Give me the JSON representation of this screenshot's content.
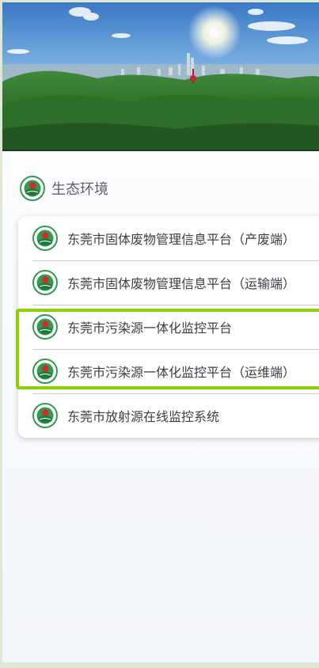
{
  "hero": {
    "icon": "city-forest-banner"
  },
  "section": {
    "title": "生态环境",
    "icon": "eco-env-logo-icon"
  },
  "platforms": [
    {
      "label": "东莞市固体废物管理信息平台（产废端）",
      "icon": "eco-env-logo-icon"
    },
    {
      "label": "东莞市固体废物管理信息平台（运输端）",
      "icon": "eco-env-logo-icon"
    },
    {
      "label": "东莞市污染源一体化监控平台",
      "icon": "eco-env-logo-icon"
    },
    {
      "label": "东莞市污染源一体化监控平台（运维端）",
      "icon": "eco-env-logo-icon"
    },
    {
      "label": "东莞市放射源在线监控系统",
      "icon": "eco-env-logo-icon"
    }
  ],
  "colors": {
    "highlight": "#8bd100",
    "logo_green": "#2e9b4e",
    "logo_red": "#d6282d"
  }
}
